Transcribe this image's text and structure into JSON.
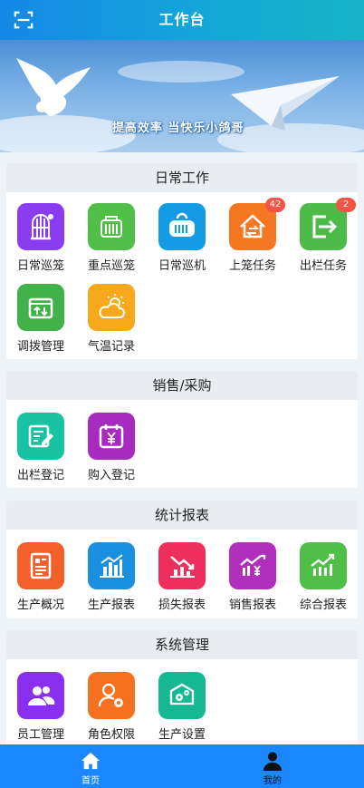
{
  "header": {
    "title": "工作台",
    "scan_icon": "scan-icon"
  },
  "banner": {
    "slogan": "提高效率 当快乐小鸽哥"
  },
  "sections": [
    {
      "title": "日常工作",
      "items": [
        {
          "label": "日常巡笼",
          "icon": "cage-icon",
          "color": "#8c3cf0"
        },
        {
          "label": "重点巡笼",
          "icon": "carrier-icon",
          "color": "#4fbf47"
        },
        {
          "label": "日常巡机",
          "icon": "transport-box-icon",
          "color": "#149be6"
        },
        {
          "label": "上笼任务",
          "icon": "house-swap-icon",
          "color": "#f57722",
          "badge": "42"
        },
        {
          "label": "出栏任务",
          "icon": "exit-icon",
          "color": "#4cbb48",
          "badge": "2"
        },
        {
          "label": "调拨管理",
          "icon": "transfer-box-icon",
          "color": "#41b14a"
        },
        {
          "label": "气温记录",
          "icon": "weather-icon",
          "color": "#f7a81b"
        }
      ]
    },
    {
      "title": "销售/采购",
      "items": [
        {
          "label": "出栏登记",
          "icon": "edit-note-icon",
          "color": "#18c3a2"
        },
        {
          "label": "购入登记",
          "icon": "calendar-yuan-icon",
          "color": "#a82bbf"
        }
      ]
    },
    {
      "title": "统计报表",
      "items": [
        {
          "label": "生产概况",
          "icon": "report-doc-icon",
          "color": "#f4602b"
        },
        {
          "label": "生产报表",
          "icon": "bar-chart-icon",
          "color": "#1a8fe0"
        },
        {
          "label": "损失报表",
          "icon": "down-chart-icon",
          "color": "#ee2f5d"
        },
        {
          "label": "销售报表",
          "icon": "sales-chart-icon",
          "color": "#b02fbc"
        },
        {
          "label": "综合报表",
          "icon": "up-chart-icon",
          "color": "#4fbf47"
        }
      ]
    },
    {
      "title": "系统管理",
      "items": [
        {
          "label": "员工管理",
          "icon": "users-icon",
          "color": "#8a2ef0"
        },
        {
          "label": "角色权限",
          "icon": "user-gear-icon",
          "color": "#f5701f"
        },
        {
          "label": "生产设置",
          "icon": "settings-box-icon",
          "color": "#16b893"
        }
      ]
    }
  ],
  "tabbar": [
    {
      "label": "首页",
      "icon": "home-icon",
      "active": true
    },
    {
      "label": "我的",
      "icon": "person-icon",
      "active": false
    }
  ]
}
